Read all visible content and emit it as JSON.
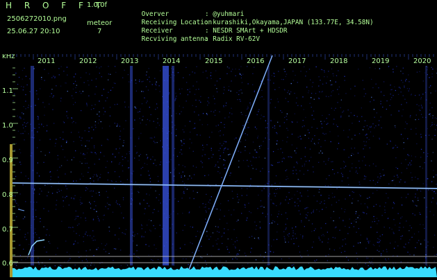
{
  "header": {
    "logo": "H R O F F T",
    "version": "1.0.0f",
    "filename": "2506272010.png",
    "mode": "meteor",
    "timestamp": "25.06.27 20:10",
    "count": "7",
    "info": [
      {
        "label": "Overver",
        "value": ": @yuhmari"
      },
      {
        "label": "Receiving Location",
        "value": ": kurashiki,Okayama,JAPAN (133.77E, 34.58N)"
      },
      {
        "label": "Receiver",
        "value": ": NESDR SMArt + HDSDR"
      },
      {
        "label": "Recviving antenna",
        "value": ": Radix RV-62V"
      }
    ]
  },
  "spectrogram": {
    "unit": "kHz",
    "time_labels": [
      "2011",
      "2012",
      "2013",
      "2014",
      "2015",
      "2016",
      "2017",
      "2018",
      "2019",
      "2020"
    ],
    "freq_labels": [
      "1.1",
      "1.0",
      "0.9",
      "0.8",
      "0.7",
      "0.6"
    ],
    "colors": {
      "label": "#b7ff9f",
      "signal": "#4f7bff",
      "ticks": "#2b44a8",
      "noise_floor": "#38dcff",
      "marker": "#ffe94a"
    }
  }
}
